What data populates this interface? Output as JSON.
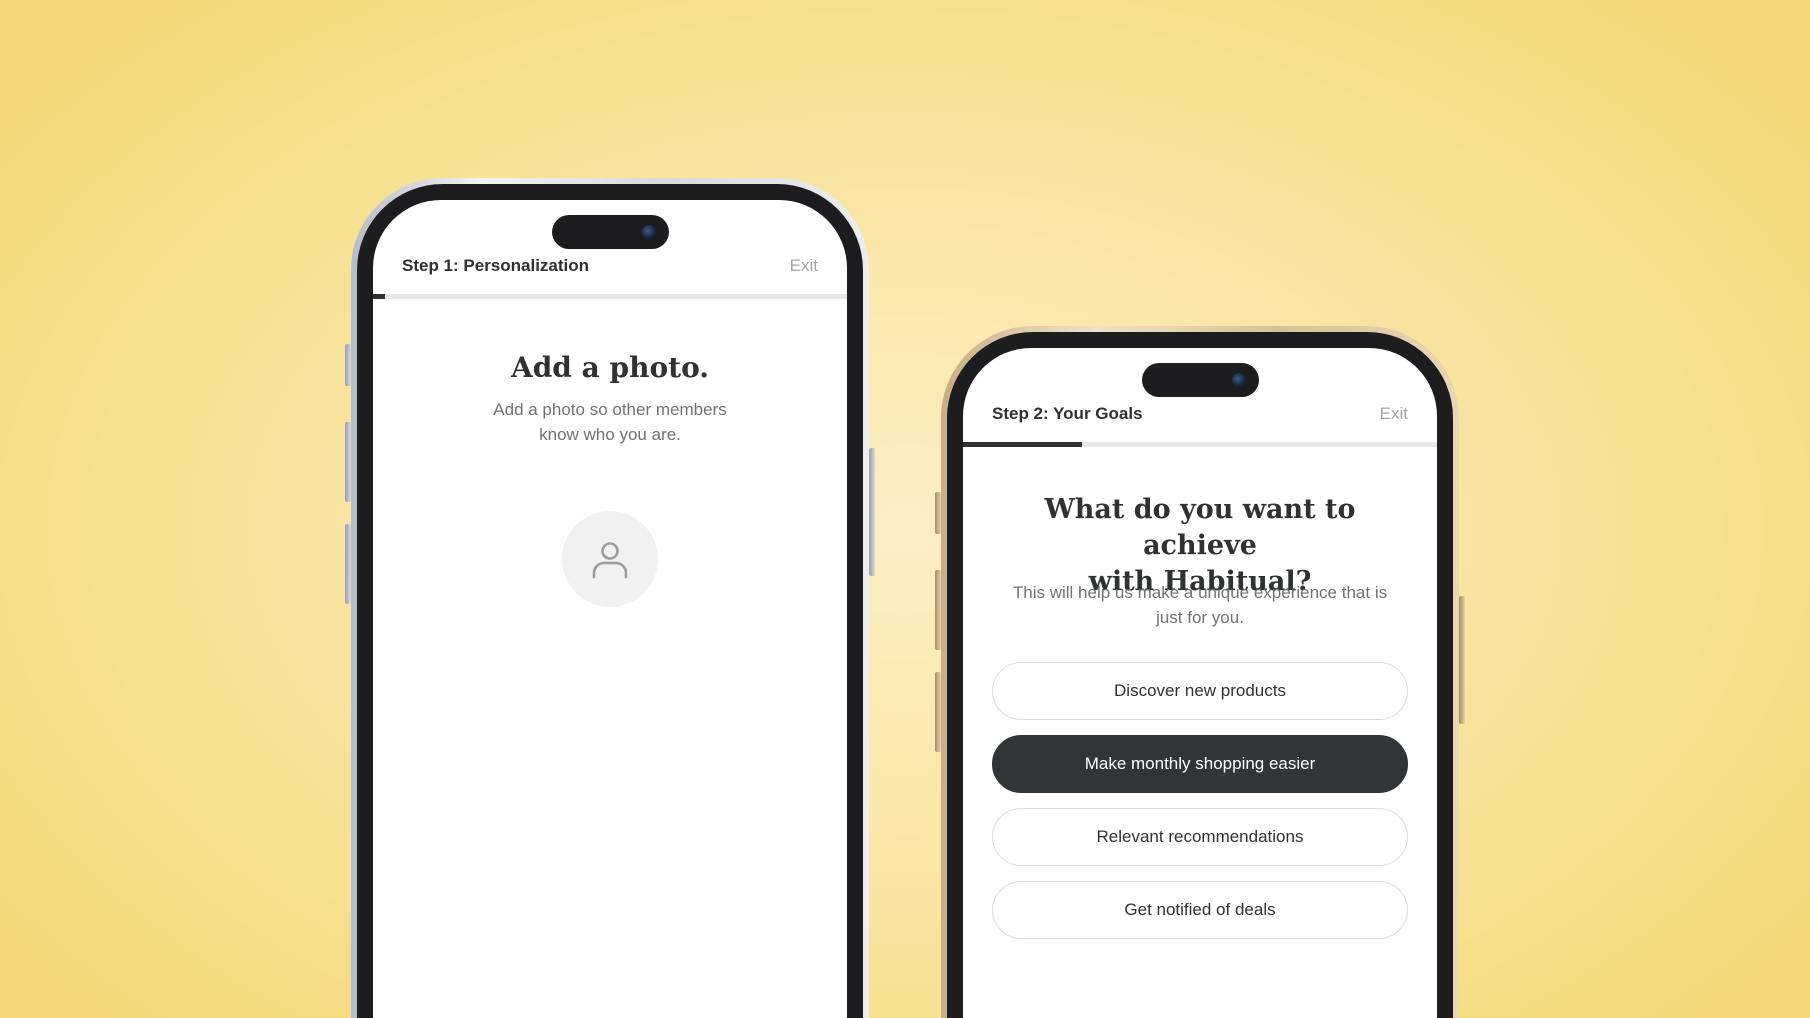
{
  "phone1": {
    "step_title": "Step 1: Personalization",
    "exit_label": "Exit",
    "progress": 0.025,
    "heading": "Add a photo.",
    "subtext_line1": "Add a photo so other members",
    "subtext_line2": "know who you are.",
    "avatar_icon": "user-icon"
  },
  "phone2": {
    "step_title": "Step 2: Your Goals",
    "exit_label": "Exit",
    "progress": 0.25,
    "heading_line1": "What do you want to achieve",
    "heading_line2": "with Habitual?",
    "subtext_line1": "This will help us make a unique experience that is",
    "subtext_line2": "just for you.",
    "options": [
      {
        "label": "Discover new products",
        "selected": false
      },
      {
        "label": "Make monthly shopping easier",
        "selected": true
      },
      {
        "label": "Relevant recommendations",
        "selected": false
      },
      {
        "label": "Get notified of deals",
        "selected": false
      }
    ]
  },
  "colors": {
    "background": "#f6dc7e",
    "primary_dark": "#323537",
    "muted_text": "#707274",
    "exit_text": "#a3a5a7"
  }
}
